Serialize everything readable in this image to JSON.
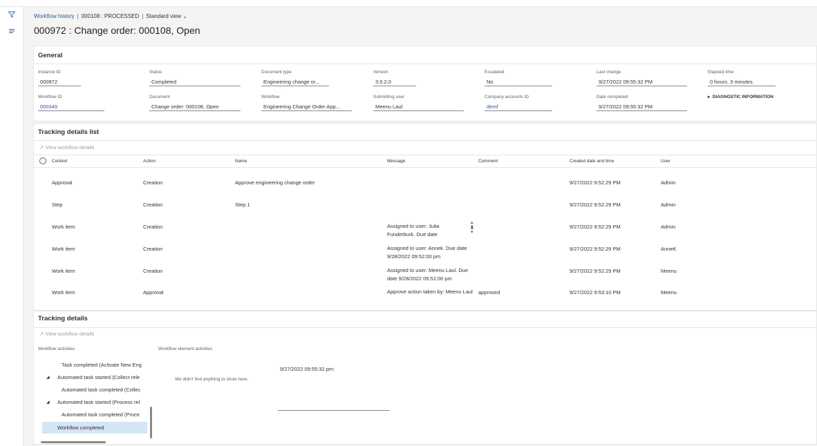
{
  "breadcrumb": {
    "link": "Workflow history",
    "record": "000108 : PROCESSED",
    "view": "Standard view"
  },
  "page_title": "000972 : Change order: 000108, Open",
  "icons": {
    "filter": "filter-icon",
    "menu": "hamburger-icon",
    "chevron": "chevron-down-icon",
    "arrow": "arrow-diagonal-icon",
    "sort": "sort-icon"
  },
  "general": {
    "title": "General",
    "fields": [
      {
        "label": "Instance ID",
        "value": "000972"
      },
      {
        "label": "Status",
        "value": "Completed"
      },
      {
        "label": "Document type",
        "value": "Engineering change or..."
      },
      {
        "label": "Version",
        "value": "3.0.2.0"
      },
      {
        "label": "Escalated",
        "value": "No"
      },
      {
        "label": "Last change",
        "value": "9/27/2022 09:55:32 PM"
      },
      {
        "label": "Elapsed time",
        "value": "0 hours. 3 minutes."
      },
      {
        "label": "Workflow ID",
        "value": "000349"
      },
      {
        "label": "Document",
        "value": "Change order: 000108, Open"
      },
      {
        "label": "Workflow",
        "value": "Engineering Change Order App..."
      },
      {
        "label": "Submitting user",
        "value": "Meenu Laul"
      },
      {
        "label": "Company accounts ID",
        "value": "demf"
      },
      {
        "label": "Date completed",
        "value": "9/27/2022 09:55:32 PM"
      }
    ],
    "diagnostic": "DIAGNOSTIC INFORMATION"
  },
  "tracking_list": {
    "title": "Tracking details list",
    "toolbar_button": "View workflow details",
    "columns": [
      "Context",
      "Action",
      "Name",
      "Message",
      "Comment",
      "Created date and time",
      "User"
    ],
    "rows": [
      {
        "context": "Approval",
        "action": "Creation",
        "name": "Approve engineering change order",
        "message": "",
        "comment": "",
        "created": "9/27/2022 9:52:29 PM",
        "user": "Admin"
      },
      {
        "context": "Step",
        "action": "Creation",
        "name": "Step 1",
        "message": "",
        "comment": "",
        "created": "9/27/2022 9:52:29 PM",
        "user": "Admin"
      },
      {
        "context": "Work item",
        "action": "Creation",
        "name": "",
        "message": "Assigned to user: Julia Funderburk. Due date",
        "comment": "",
        "created": "9/27/2022 9:52:29 PM",
        "user": "Admin"
      },
      {
        "context": "Work item",
        "action": "Creation",
        "name": "",
        "message": "Assigned to user: Annek. Due date 9/28/2022 09:52:00 pm",
        "comment": "",
        "created": "9/27/2022 9:52:29 PM",
        "user": "AnneK"
      },
      {
        "context": "Work item",
        "action": "Creation",
        "name": "",
        "message": "Assigned to user: Meenu Laul. Due date 9/28/2022 09:52:00 pm",
        "comment": "",
        "created": "9/27/2022 9:52:29 PM",
        "user": "Meenu"
      },
      {
        "context": "Work item",
        "action": "Approval",
        "name": "",
        "message": "Approve action taken by: Meenu Laul",
        "comment": "approved",
        "created": "9/27/2022 9:53:10 PM",
        "user": "Meenu"
      }
    ]
  },
  "tracking_details": {
    "title": "Tracking details",
    "toolbar_button": "View workflow details",
    "activities_label": "Workflow activities",
    "element_label": "Workflow element activities",
    "empty_message": "We didn't find anything to show here.",
    "timestamp": "9/27/2022 09:55:32 pm:",
    "tree": [
      {
        "text": "Task completed (Activate New Eng"
      },
      {
        "text": "Automated task started (Collect rele"
      },
      {
        "text": "Automated task completed (Collec"
      },
      {
        "text": "Automated task started (Process rel"
      },
      {
        "text": "Automated task completed (Proce"
      },
      {
        "text": "Workflow completed"
      }
    ]
  }
}
